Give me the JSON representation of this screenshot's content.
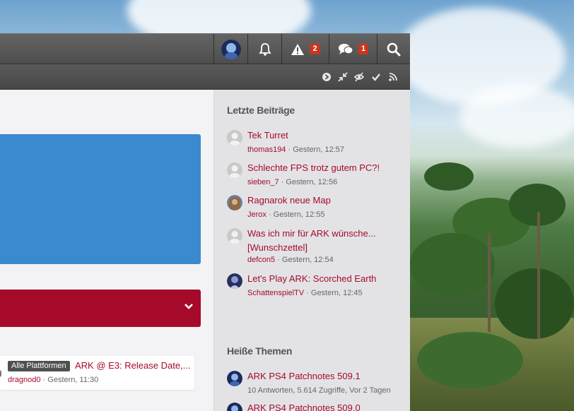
{
  "topbar": {
    "notifications_badge": "",
    "warnings_badge": "2",
    "messages_badge": "1",
    "icons": [
      "user-avatar",
      "bell-icon",
      "warning-icon",
      "chat-icon",
      "search-icon"
    ]
  },
  "subbar": {
    "icons": [
      "arrow-right-circle-icon",
      "collapse-icon",
      "hide-icon",
      "check-icon",
      "rss-icon"
    ]
  },
  "main": {
    "post": {
      "tag": "Alle Plattformen",
      "title": "ARK @ E3: Release Date,...",
      "author": "dragnod0",
      "time": " · Gestern, 11:30"
    }
  },
  "sidebar": {
    "recent_heading": "Letzte Beiträge",
    "recent": [
      {
        "title": "Tek Turret",
        "title2": "",
        "author": "thomas194",
        "time": " · Gestern, 12:57"
      },
      {
        "title": "Schlechte FPS trotz gutem PC?!",
        "title2": "",
        "author": "sieben_7",
        "time": " · Gestern, 12:56"
      },
      {
        "title": "Ragnarok neue Map",
        "title2": "",
        "author": "Jerox",
        "time": " · Gestern, 12:55"
      },
      {
        "title": "Was ich mir für ARK wünsche...",
        "title2": "[Wunschzettel]",
        "author": "defcon5",
        "time": " · Gestern, 12:54"
      },
      {
        "title": "Let's Play ARK: Scorched Earth",
        "title2": "",
        "author": "SchattenspielTV",
        "time": " · Gestern, 12:45"
      }
    ],
    "hot_heading": "Heiße Themen",
    "hot": [
      {
        "title": "ARK PS4 Patchnotes 509.1",
        "meta": "10 Antworten, 5.614 Zugriffe, Vor 2 Tagen"
      },
      {
        "title": "ARK PS4 Patchnotes 509.0",
        "meta": ""
      }
    ]
  },
  "colors": {
    "accent_red": "#a60a2a",
    "blue_box": "#3b89cf",
    "badge": "#c8361f",
    "nav_dark": "#4e4e4e"
  }
}
